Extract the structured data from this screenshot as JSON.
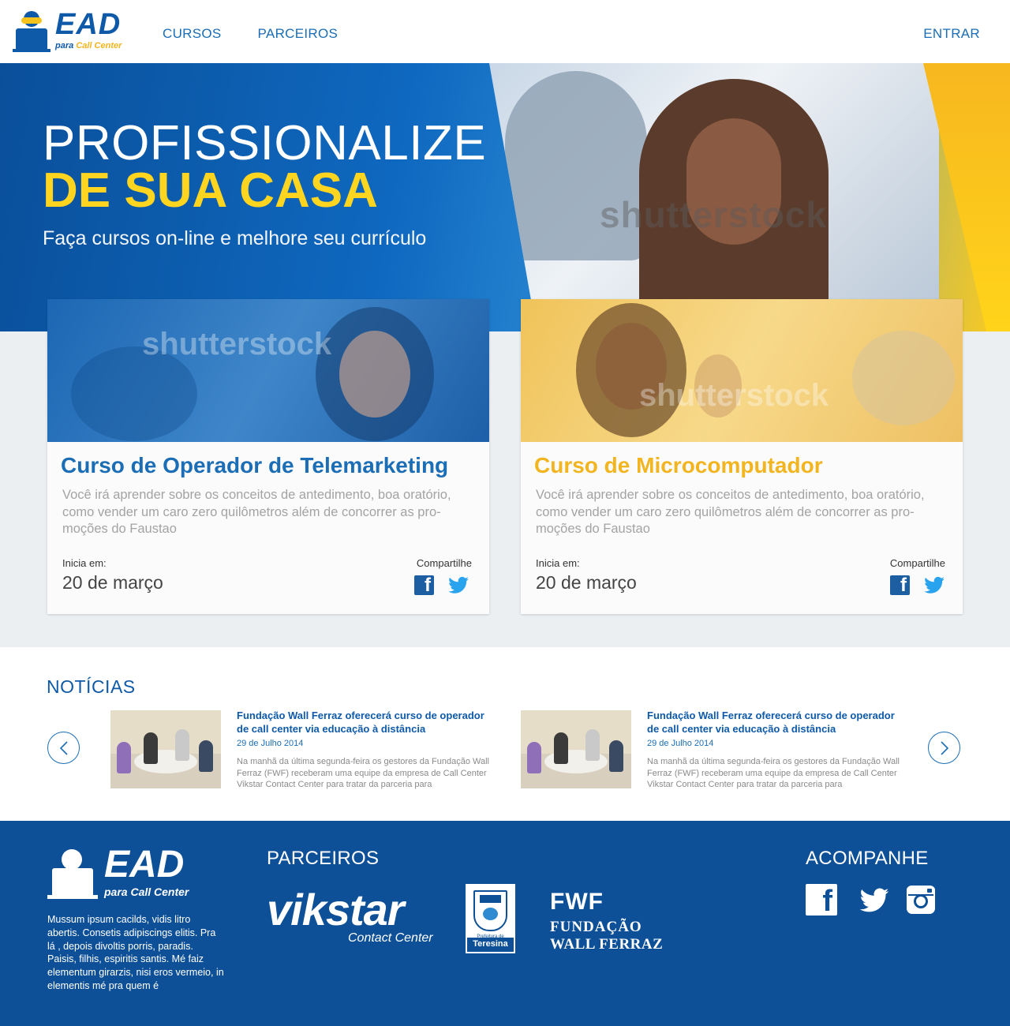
{
  "header": {
    "logo_main": "EAD",
    "logo_sub_prefix": "para",
    "logo_sub_accent": "Call Center",
    "nav": [
      "CURSOS",
      "PARCEIROS"
    ],
    "login": "ENTRAR"
  },
  "hero": {
    "line1": "PROFISSIONALIZE",
    "line2": "DE SUA CASA",
    "tagline": "Faça cursos on-line e melhore seu currículo",
    "watermark": "shutterstock"
  },
  "courses": [
    {
      "title": "Curso de Operador de Telemarketing",
      "description": "Você irá aprender sobre os conceitos de antedimento, boa oratório, como vender um caro zero quilômetros além de concorrer as pro-moções do Faustao",
      "starts_label": "Inicia em:",
      "starts_date": "20 de março",
      "share_label": "Compartilhe",
      "watermark": "shutterstock"
    },
    {
      "title": "Curso de Microcomputador",
      "description": "Você irá aprender sobre os conceitos de antedimento, boa oratório, como vender um caro zero quilômetros além de concorrer as pro-moções do Faustao",
      "starts_label": "Inicia em:",
      "starts_date": "20 de março",
      "share_label": "Compartilhe",
      "watermark": "shutterstock"
    }
  ],
  "news": {
    "title": "NOTÍCIAS",
    "items": [
      {
        "headline": "Fundação Wall Ferraz oferecerá curso de operador de call center via educação à distância",
        "date": "29 de Julho 2014",
        "summary": "Na manhã da última segunda-feira os gestores da Fundação Wall Ferraz (FWF) receberam uma equipe da empresa de Call Center Vikstar Contact Center para tratar da parceria para"
      },
      {
        "headline": "Fundação Wall Ferraz oferecerá curso de operador de call center via educação à distância",
        "date": "29 de Julho 2014",
        "summary": "Na manhã da última segunda-feira os gestores da Fundação Wall Ferraz (FWF) receberam uma equipe da empresa de Call Center Vikstar Contact Center para tratar da parceria para"
      }
    ]
  },
  "footer": {
    "logo_main": "EAD",
    "logo_sub": "para Call Center",
    "about": "Mussum ipsum cacilds, vidis litro abertis. Consetis adipiscings elitis. Pra lá , depois divoltis porris, paradis. Paisis, filhis, espiritis santis. Mé faiz elementum girarzis, nisi eros vermeio, in elementis mé pra quem é",
    "partners_title": "PARCEIROS",
    "partners": {
      "vikstar_name": "vikstar",
      "vikstar_sub": "Contact Center",
      "teresina_pref": "Prefeitura de",
      "teresina_name": "Teresina",
      "fwf_abbr": "FWF",
      "fwf_line1": "FUNDAÇÃO",
      "fwf_line2": "WALL FERRAZ"
    },
    "follow_title": "ACOMPANHE",
    "social_icons": [
      "facebook-icon",
      "twitter-icon",
      "instagram-icon"
    ]
  },
  "colors": {
    "brand_blue": "#0f5aa8",
    "link_blue": "#1b6eb5",
    "accent_yellow": "#f2b51f",
    "footer_blue": "#0e5097",
    "section_grey": "#ebeff1"
  }
}
